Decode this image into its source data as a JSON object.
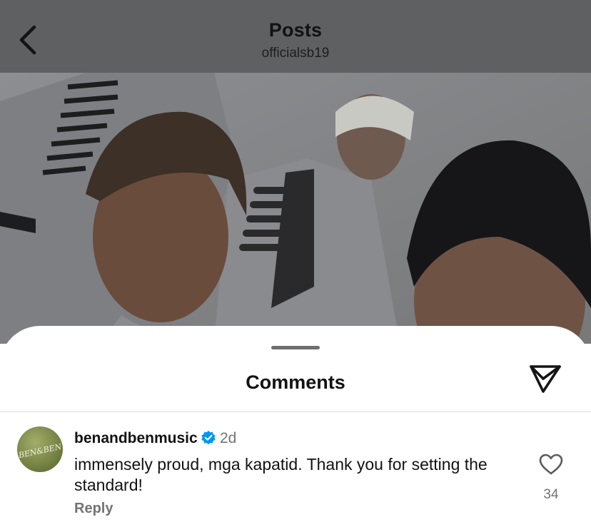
{
  "header": {
    "title": "Posts",
    "subtitle": "officialsb19",
    "back_icon": "chevron-left-icon"
  },
  "post": {
    "image_description_icon": "photo"
  },
  "comments_sheet": {
    "title": "Comments",
    "share_icon": "send-icon",
    "comments": [
      {
        "username": "benandbenmusic",
        "verified": true,
        "time": "2d",
        "text": "immensely proud, mga kapatid. Thank you for setting the standard!",
        "reply_label": "Reply",
        "like_count": "34",
        "avatar_text": "BEN&BEN"
      }
    ]
  },
  "colors": {
    "header_bg": "#5f6062",
    "verified_blue": "#0095f6",
    "secondary_text": "#737373"
  }
}
